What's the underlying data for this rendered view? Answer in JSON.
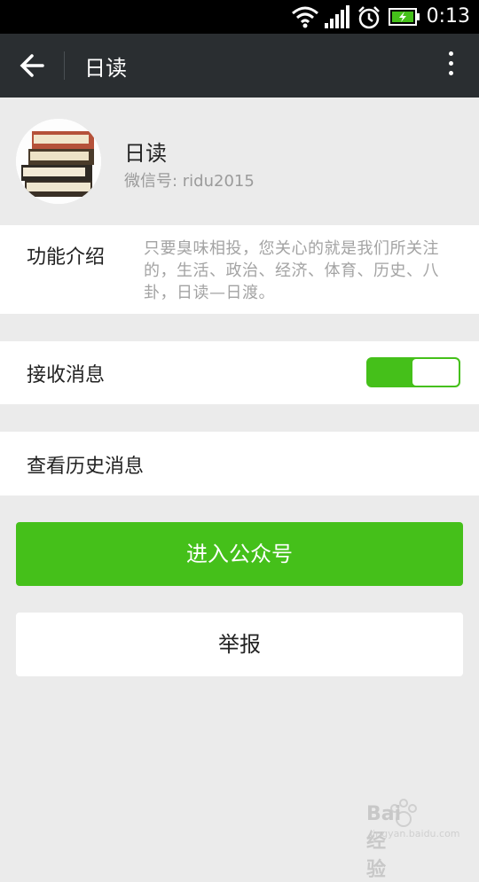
{
  "status_bar": {
    "time": "0:13",
    "icons": [
      "wifi-icon",
      "signal-icon",
      "alarm-icon",
      "battery-charging-icon"
    ]
  },
  "app_bar": {
    "title": "日读",
    "back_icon": "arrow-left-icon",
    "menu_icon": "more-vertical-icon"
  },
  "profile": {
    "name": "日读",
    "wechat_id": "微信号: ridu2015"
  },
  "intro": {
    "label": "功能介绍",
    "text": "只要臭味相投，您关心的就是我们所关注的，生活、政治、经济、体育、历史、八卦，日读—日渡。"
  },
  "receive": {
    "label": "接收消息",
    "enabled": true
  },
  "history": {
    "label": "查看历史消息"
  },
  "buttons": {
    "enter": "进入公众号",
    "report": "举报"
  },
  "colors": {
    "accent": "#45c01a",
    "app_bar": "#2a2e31",
    "background": "#ebebeb"
  },
  "watermark": {
    "text": "Bai经验",
    "sub": "jingyan.baidu.com"
  }
}
